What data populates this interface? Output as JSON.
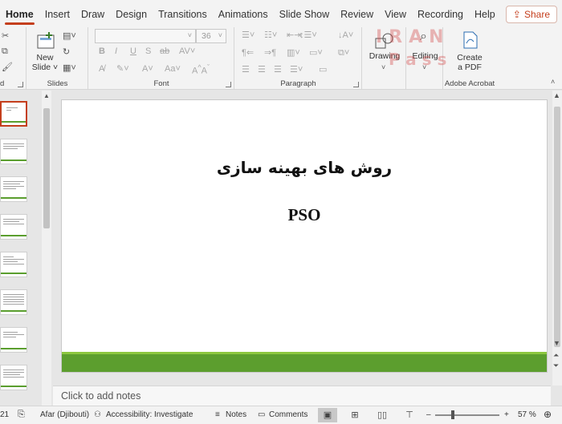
{
  "tabs": [
    {
      "label": "Home",
      "active": true
    },
    {
      "label": "Insert"
    },
    {
      "label": "Draw"
    },
    {
      "label": "Design"
    },
    {
      "label": "Transitions"
    },
    {
      "label": "Animations"
    },
    {
      "label": "Slide Show"
    },
    {
      "label": "Review"
    },
    {
      "label": "View"
    },
    {
      "label": "Recording"
    },
    {
      "label": "Help"
    },
    {
      "label": "Acrobat"
    }
  ],
  "share": {
    "label": "Share",
    "icon": "share-icon"
  },
  "ribbon": {
    "clipboard_label": "d",
    "slides": {
      "new_slide_label_1": "New",
      "new_slide_label_2": "Slide",
      "group_label": "Slides"
    },
    "font": {
      "font_name": "",
      "font_size": "36",
      "group_label": "Font"
    },
    "paragraph": {
      "group_label": "Paragraph"
    },
    "drawing": {
      "label": "Drawing"
    },
    "editing": {
      "label": "Editing"
    },
    "acrobat": {
      "create_label_1": "Create",
      "create_label_2": "a PDF",
      "group_label": "Adobe Acrobat"
    }
  },
  "watermark": {
    "line1": "IRAN",
    "line2": "Pass"
  },
  "slide": {
    "title": "روش های بهینه سازی",
    "subtitle": "PSO",
    "accent_color": "#5c9e2e"
  },
  "notes": {
    "placeholder": "Click to add notes"
  },
  "status": {
    "slide_counter": "21",
    "language": "Afar (Djibouti)",
    "accessibility": "Accessibility: Investigate",
    "notes_label": "Notes",
    "comments_label": "Comments",
    "zoom": "57 %"
  },
  "colors": {
    "accent": "#c43e1c",
    "slide_green": "#5c9e2e"
  }
}
